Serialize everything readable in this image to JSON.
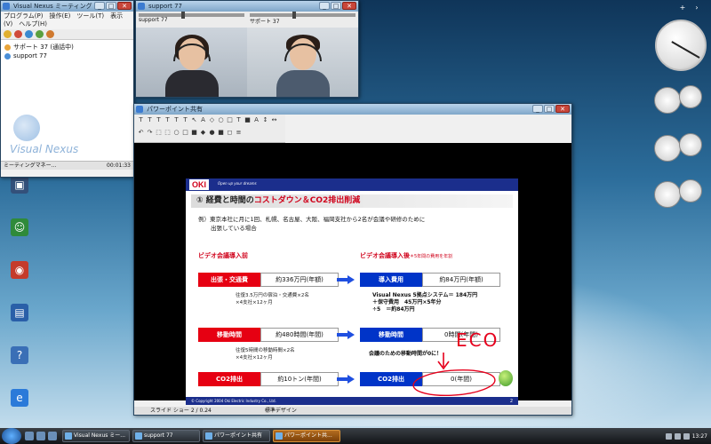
{
  "colors": {
    "slide_red": "#e60012",
    "slide_blue": "#0034c8",
    "oki_navy": "#1b2e8c",
    "eco_red": "#e6001c"
  },
  "vn_window": {
    "title": "Visual Nexus ミーティング",
    "menu": "プログラム(P)　操作(E)　ツール(T)　表示(V)　ヘルプ(H)",
    "tree": [
      {
        "label": "サポート 37 (通話中)"
      },
      {
        "label": "support 77"
      }
    ],
    "logo": "Visual Nexus",
    "status_left": "ミーティングマネー...",
    "status_right": "00:01:33"
  },
  "video_window": {
    "title": "support 77",
    "left_label": "support 77",
    "right_label": "サポート 37"
  },
  "ppt_window": {
    "title": "パワーポイント共有",
    "tool_glyphs": [
      "T",
      "T",
      "T",
      "T",
      "T",
      "T",
      "↖",
      "A",
      "◇",
      "○",
      "□",
      "T",
      "■",
      "A",
      "↕",
      "↔",
      "↶",
      "↷",
      "⬚",
      "⬚",
      "○",
      "□",
      "■",
      "◆",
      "●",
      "■",
      "◻",
      "≡"
    ],
    "status": [
      "スライド ショー 2 / 0.24",
      "標準デザイン"
    ]
  },
  "slide": {
    "logo": "OKI",
    "tagline": "Open up your dreams",
    "title_num": "①",
    "title_a": "経費と時間の",
    "title_b": "コストダウン＆CO2排出削減",
    "intro_1": "例）東京本社に月に1回、札幌、名古屋、大阪、福岡支社から2名が会議や研修のために",
    "intro_2": "出張している場合",
    "left_head": "ビデオ会議導入前",
    "right_head": "ビデオ会議導入後",
    "right_head_note": "＊5年間の費用を年割",
    "rows": [
      {
        "left_tag": "出張・交通費",
        "left_val": "約336万円(年額)",
        "right_tag": "導入費用",
        "right_val": "約84万円(年額)"
      },
      {
        "left_tag": "移動時間",
        "left_val": "約480時間(年間)",
        "right_tag": "移動時間",
        "right_val": "0時間(年間)"
      },
      {
        "left_tag": "CO2排出",
        "left_val": "約10トン(年間)",
        "right_tag": "CO2排出",
        "right_val": "0(年間)"
      }
    ],
    "note_left_1a": "往復3.5万円の宿泊・交通費×2名",
    "note_left_1b": "×4支社×12ヶ月",
    "note_right_1a": "Visual Nexus 5拠点システム＝ 184万円",
    "note_right_1b": "＋保守費用　45万円×5年分",
    "note_right_1c": "÷5　＝約84万円",
    "note_left_2a": "往復5時間の移動時間×2名",
    "note_left_2b": "×4支社×12ヶ月",
    "note_right_2": "会議のための移動時間が0に！",
    "copyright": "© Copyright 2004 Oki Electric Industry Co., Ltd.",
    "page_num": "2",
    "handwritten": "ECO"
  },
  "taskbar": {
    "tasks": [
      "Visual Nexus ミー...",
      "support 77",
      "パワーポイント共有",
      "パワーポイント共..."
    ],
    "clock": "13:27"
  }
}
